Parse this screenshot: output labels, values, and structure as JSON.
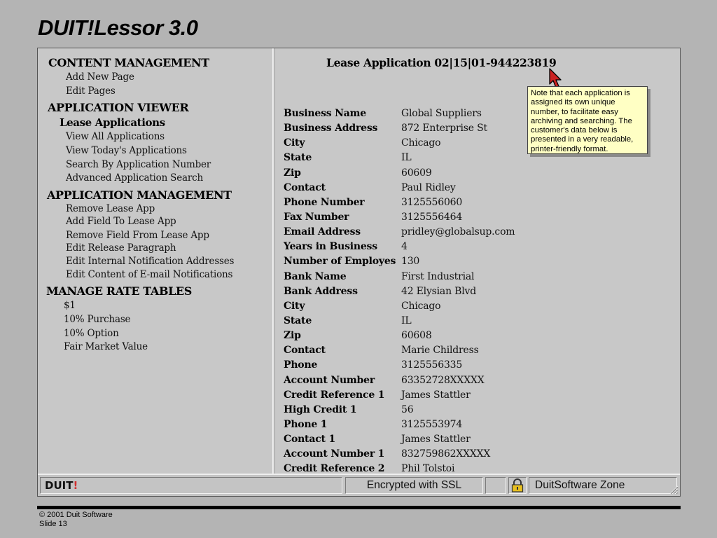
{
  "slide": {
    "title": "DUIT!Lessor 3.0",
    "copyright": "© 2001 Duit Software",
    "slide_number": "Slide 13"
  },
  "nav": {
    "content_management": {
      "heading": "CONTENT MANAGEMENT",
      "links": [
        "Add New Page",
        "Edit Pages"
      ]
    },
    "application_viewer": {
      "heading": "APPLICATION VIEWER",
      "subheading": "Lease Applications",
      "links": [
        "View All Applications",
        "View Today's Applications",
        "Search By Application Number",
        "Advanced Application Search"
      ]
    },
    "application_management": {
      "heading": "APPLICATION MANAGEMENT",
      "links": [
        "Remove Lease App",
        "Add Field To Lease App",
        "Remove Field From Lease App",
        "Edit Release Paragraph",
        "Edit Internal Notification Addresses",
        "Edit Content of E-mail Notifications"
      ]
    },
    "manage_rate_tables": {
      "heading": "MANAGE RATE TABLES",
      "links": [
        "$1",
        "10% Purchase",
        "10% Option",
        "Fair Market Value"
      ]
    }
  },
  "application": {
    "heading": "Lease Application 02|15|01-944223819",
    "fields": [
      {
        "label": "Business Name",
        "value": "Global Suppliers"
      },
      {
        "label": "Business Address",
        "value": "872 Enterprise St"
      },
      {
        "label": "City",
        "value": "Chicago"
      },
      {
        "label": "State",
        "value": "IL"
      },
      {
        "label": "Zip",
        "value": "60609"
      },
      {
        "label": "Contact",
        "value": "Paul Ridley"
      },
      {
        "label": "Phone Number",
        "value": "3125556060"
      },
      {
        "label": "Fax Number",
        "value": "3125556464"
      },
      {
        "label": "Email Address",
        "value": "pridley@globalsup.com"
      },
      {
        "label": "Years in Business",
        "value": "4"
      },
      {
        "label": "Number of Employes",
        "value": "130"
      },
      {
        "label": "Bank Name",
        "value": "First Industrial"
      },
      {
        "label": "Bank Address",
        "value": "42 Elysian Blvd"
      },
      {
        "label": "City",
        "value": "Chicago"
      },
      {
        "label": "State",
        "value": "IL"
      },
      {
        "label": "Zip",
        "value": "60608"
      },
      {
        "label": "Contact",
        "value": "Marie Childress"
      },
      {
        "label": "Phone",
        "value": "3125556335"
      },
      {
        "label": "Account Number",
        "value": "63352728XXXXX"
      },
      {
        "label": "Credit Reference 1",
        "value": "James Stattler"
      },
      {
        "label": "High Credit 1",
        "value": "56"
      },
      {
        "label": "Phone 1",
        "value": "3125553974"
      },
      {
        "label": "Contact 1",
        "value": "James Stattler"
      },
      {
        "label": "Account Number 1",
        "value": "832759862XXXXX"
      },
      {
        "label": "Credit Reference 2",
        "value": "Phil Tolstoi"
      }
    ]
  },
  "callout": {
    "text": "Note that each application is assigned its own unique number, to facilitate easy archiving and searching.  The customer's data below is presented in a very readable, printer-friendly format."
  },
  "status_bar": {
    "brand_main": "DUIT",
    "brand_bang": "!",
    "ssl_text": "Encrypted with SSL",
    "zone_text": "DuitSoftware Zone"
  },
  "colors": {
    "background": "#b4b4b4",
    "frame": "#c8c8c8",
    "callout_bg": "#ffffc4",
    "cursor": "#cc2222",
    "brand_accent": "#d03030"
  },
  "icons": [
    "red-arrow-cursor-icon",
    "padlock-icon",
    "resize-grip-icon"
  ]
}
